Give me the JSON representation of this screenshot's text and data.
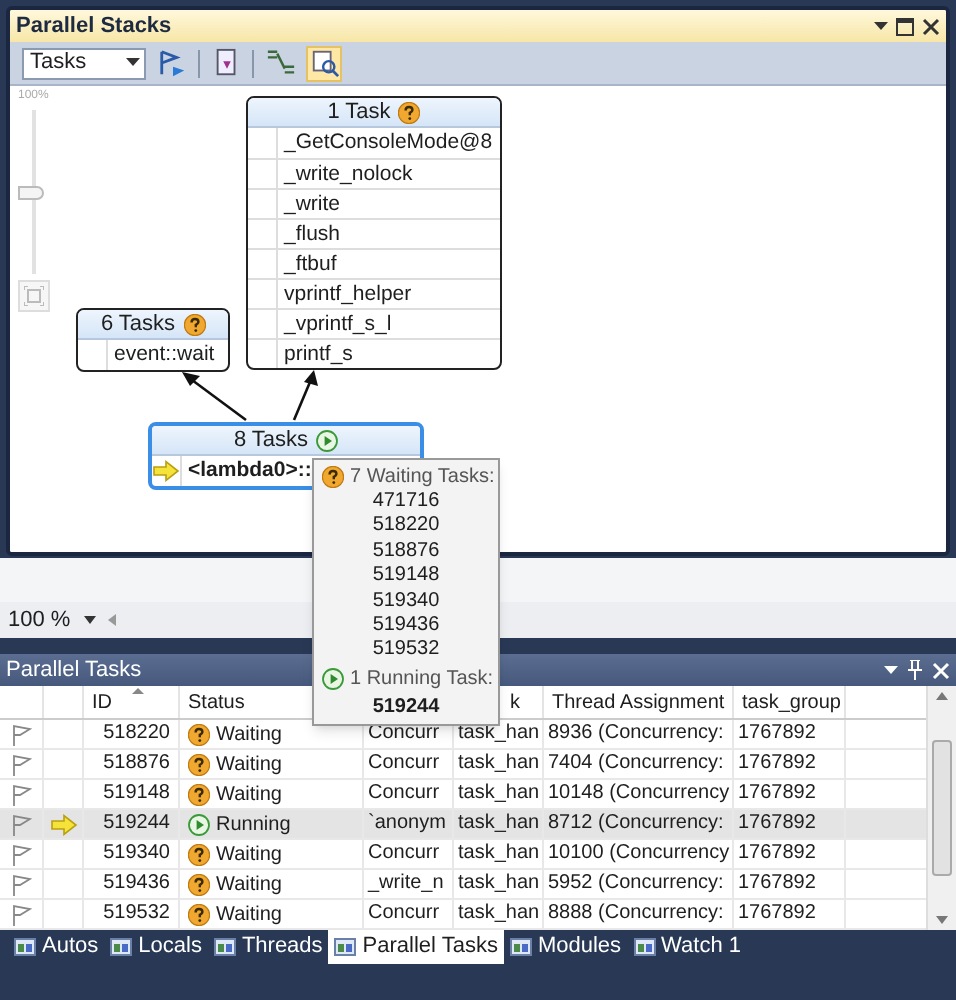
{
  "stacks_window": {
    "title": "Parallel Stacks",
    "view_dropdown": "Tasks",
    "toolbar_buttons": [
      {
        "on": false
      },
      {
        "on": false
      },
      {
        "on": false
      },
      {
        "on": true
      }
    ],
    "zoom_slider": {
      "label": "100%",
      "level": 0.5
    },
    "nodes": [
      {
        "header": "6 Tasks",
        "running": false,
        "selected": false,
        "frames": [
          {
            "text": "event::wait",
            "current": false
          }
        ]
      },
      {
        "header": "1 Task",
        "running": false,
        "selected": false,
        "frames": [
          {
            "text": "_GetConsoleMode@8",
            "current": false
          },
          {
            "text": "_write_nolock",
            "current": false
          },
          {
            "text": "_write",
            "current": false
          },
          {
            "text": "_flush",
            "current": false
          },
          {
            "text": "_ftbuf",
            "current": false
          },
          {
            "text": "vprintf_helper",
            "current": false
          },
          {
            "text": "_vprintf_s_l",
            "current": false
          },
          {
            "text": "printf_s",
            "current": false
          }
        ]
      },
      {
        "header": "8 Tasks",
        "running": true,
        "selected": true,
        "frames": [
          {
            "text": "<lambda0>::",
            "current": true
          }
        ]
      }
    ],
    "tooltip": {
      "waiting_label": "7 Waiting Tasks:",
      "waiting_ids": [
        "471716",
        "518220",
        "518876",
        "519148",
        "519340",
        "519436",
        "519532"
      ],
      "running_label": "1 Running Task:",
      "running_ids": [
        "519244"
      ]
    },
    "zoom_combo": "100 %"
  },
  "tasks_window": {
    "title": "Parallel Tasks",
    "columns": [
      {
        "label": "ID"
      },
      {
        "label": "Status"
      },
      {},
      {
        "label": "k"
      },
      {
        "label": "Thread Assignment"
      },
      {
        "label": "task_group"
      }
    ],
    "rows": [
      {
        "flagged": false,
        "current": false,
        "id": "518220",
        "status": "Waiting",
        "running": false,
        "location": "Concurr",
        "task": "task_han",
        "thread": "8936 (Concurrency:",
        "group": "1767892"
      },
      {
        "flagged": false,
        "current": false,
        "id": "518876",
        "status": "Waiting",
        "running": false,
        "location": "Concurr",
        "task": "task_han",
        "thread": "7404 (Concurrency:",
        "group": "1767892"
      },
      {
        "flagged": false,
        "current": false,
        "id": "519148",
        "status": "Waiting",
        "running": false,
        "location": "Concurr",
        "task": "task_han",
        "thread": "10148 (Concurrency",
        "group": "1767892"
      },
      {
        "flagged": false,
        "current": true,
        "id": "519244",
        "status": "Running",
        "running": true,
        "location": "`anonym",
        "task": "task_han",
        "thread": "8712 (Concurrency:",
        "group": "1767892"
      },
      {
        "flagged": false,
        "current": false,
        "id": "519340",
        "status": "Waiting",
        "running": false,
        "location": "Concurr",
        "task": "task_han",
        "thread": "10100 (Concurrency",
        "group": "1767892"
      },
      {
        "flagged": false,
        "current": false,
        "id": "519436",
        "status": "Waiting",
        "running": false,
        "location": "_write_n",
        "task": "task_han",
        "thread": "5952 (Concurrency:",
        "group": "1767892"
      },
      {
        "flagged": false,
        "current": false,
        "id": "519532",
        "status": "Waiting",
        "running": false,
        "location": "Concurr",
        "task": "task_han",
        "thread": "8888 (Concurrency:",
        "group": "1767892"
      }
    ]
  },
  "tabs": [
    {
      "label": "Autos",
      "selected": false
    },
    {
      "label": "Locals",
      "selected": false
    },
    {
      "label": "Threads",
      "selected": false
    },
    {
      "label": "Parallel Tasks",
      "selected": true
    },
    {
      "label": "Modules",
      "selected": false
    },
    {
      "label": "Watch 1",
      "selected": false
    }
  ]
}
